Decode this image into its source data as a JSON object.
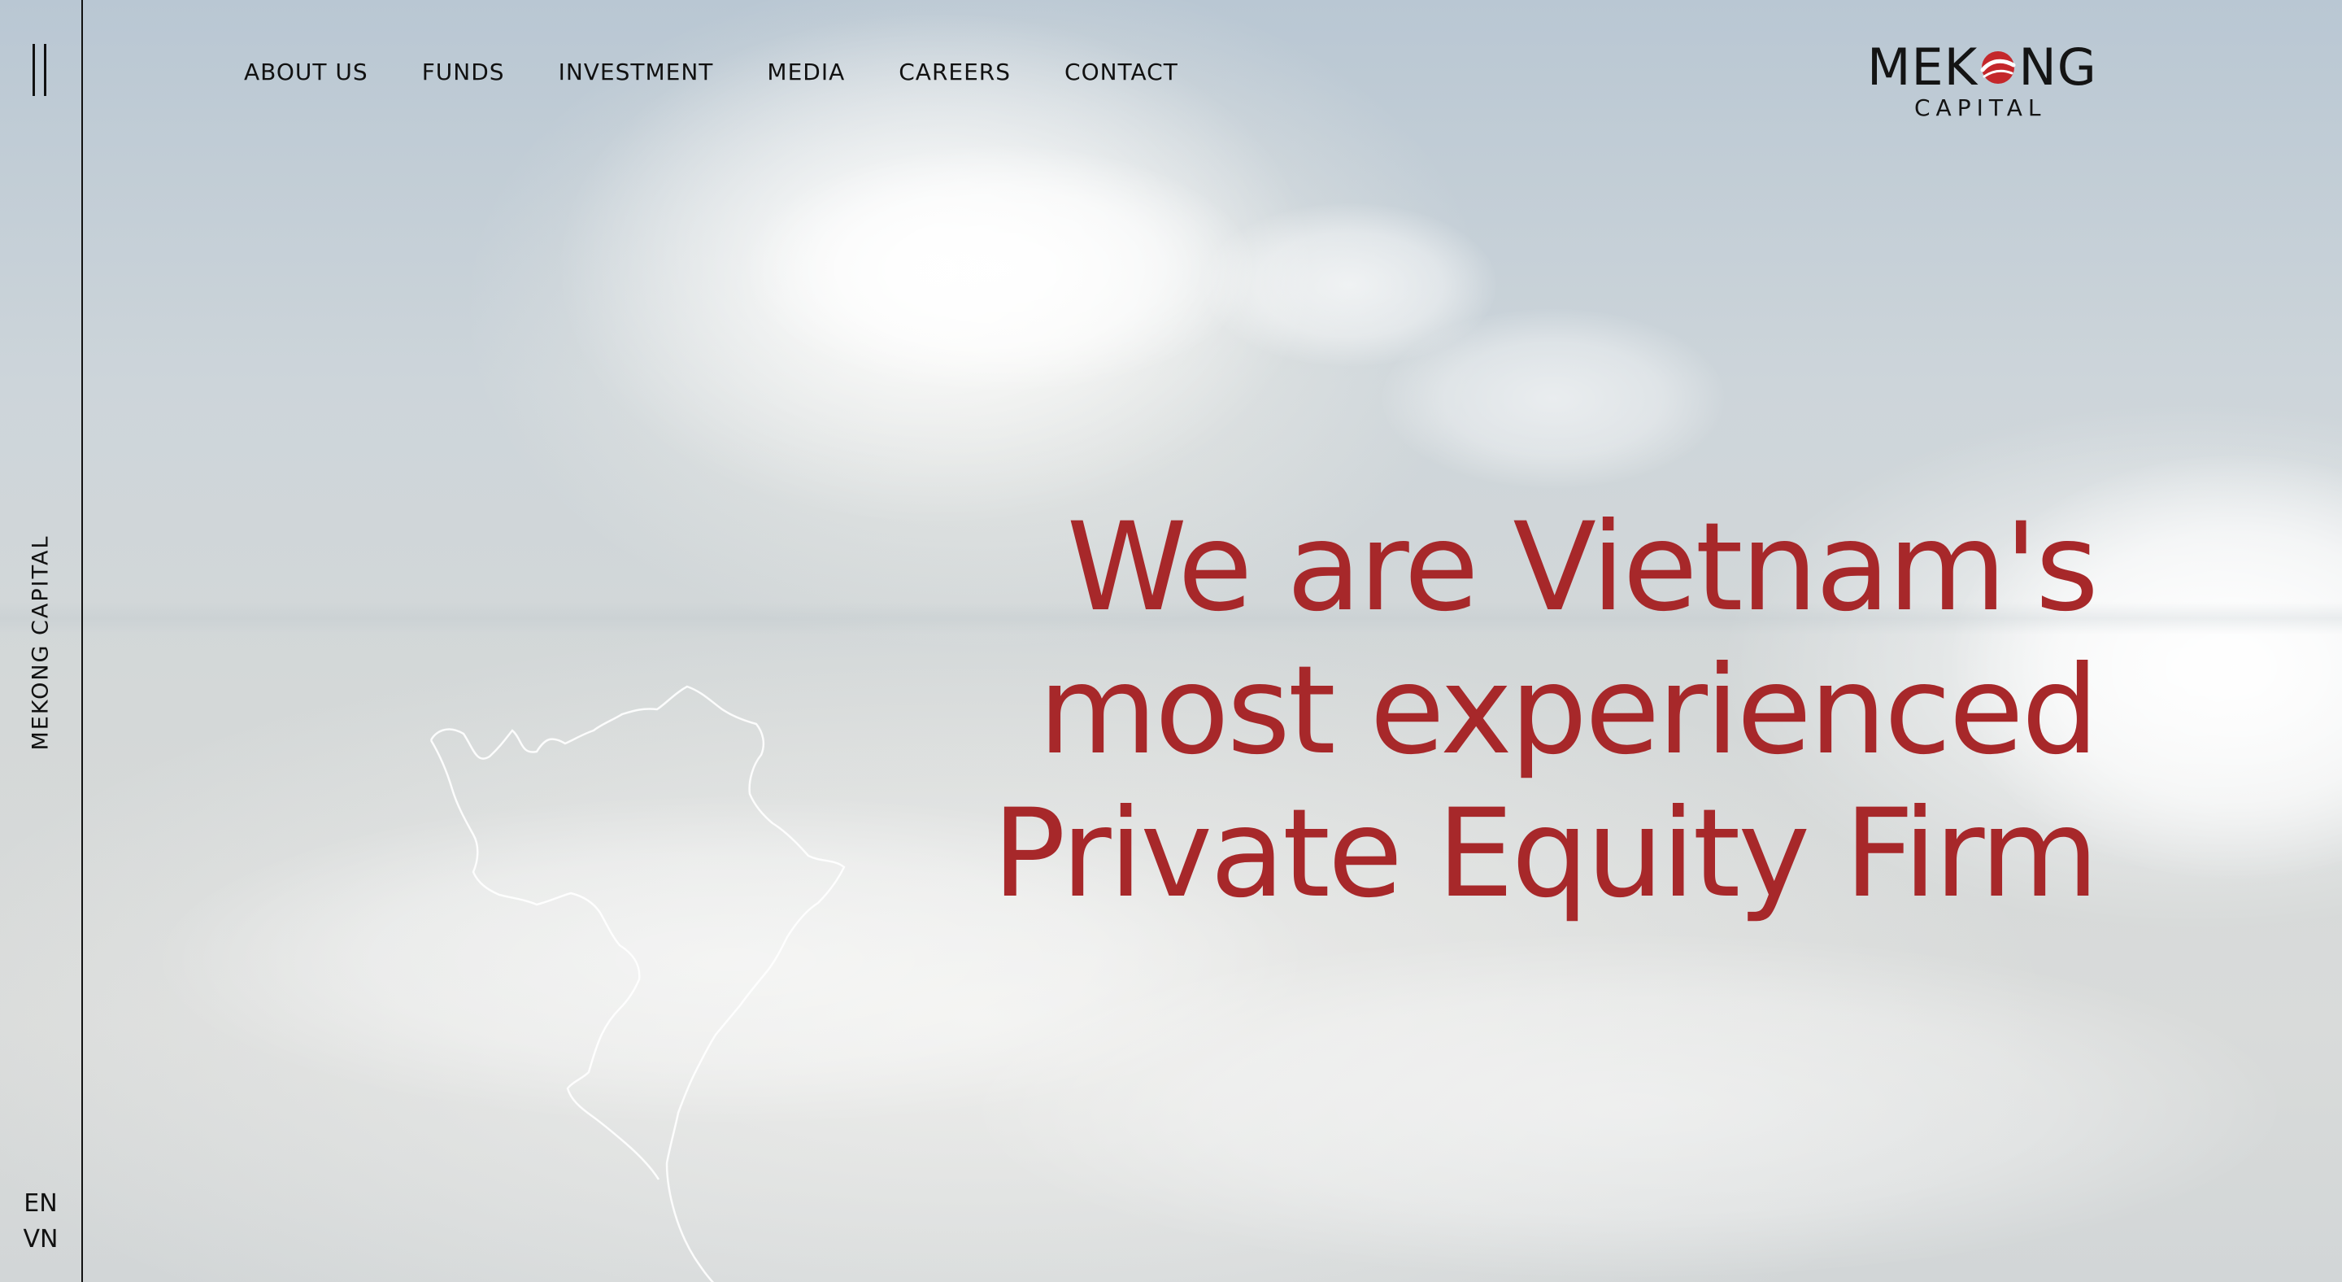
{
  "side_rail": {
    "menu_icon": "double-vertical-bars-icon",
    "brand_vertical": "MEKONG CAPITAL",
    "languages": [
      "EN",
      "VN"
    ]
  },
  "nav": {
    "items": [
      "ABOUT US",
      "FUNDS",
      "INVESTMENT",
      "MEDIA",
      "CAREERS",
      "CONTACT"
    ]
  },
  "logo": {
    "top_left": "MEK",
    "top_right": "NG",
    "bottom": "CAPITAL",
    "accent_color": "#c4272b"
  },
  "hero": {
    "headline_lines": [
      "We are Vietnam's",
      "most experienced",
      "Private Equity Firm"
    ],
    "headline_color": "#a7282a"
  }
}
